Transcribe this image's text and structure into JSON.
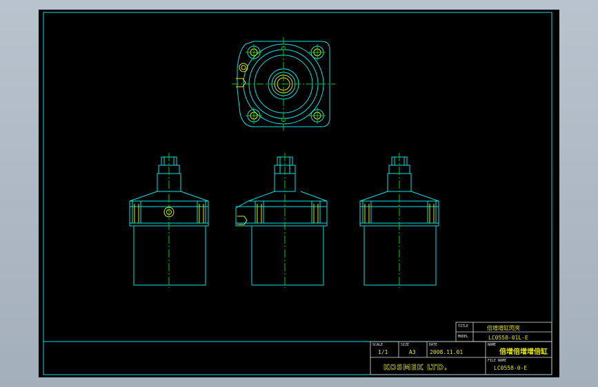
{
  "title_block": {
    "title_label": "TITLE",
    "title_value": "倍增增缸閃夾",
    "model_label": "MODEL",
    "model_value": "LC0558-01L-E",
    "name_label": "NAME",
    "name_value": "倍增倍增增倍缸",
    "scale_label": "SCALE",
    "scale_value": "1/1",
    "size_label": "SIZE",
    "size_value": "A3",
    "date_label": "DATE",
    "date_value": "2008.11.01",
    "file_label": "FILE NAME",
    "file_value": "LC0558-0-E",
    "company": "KOSMEK LTD."
  }
}
